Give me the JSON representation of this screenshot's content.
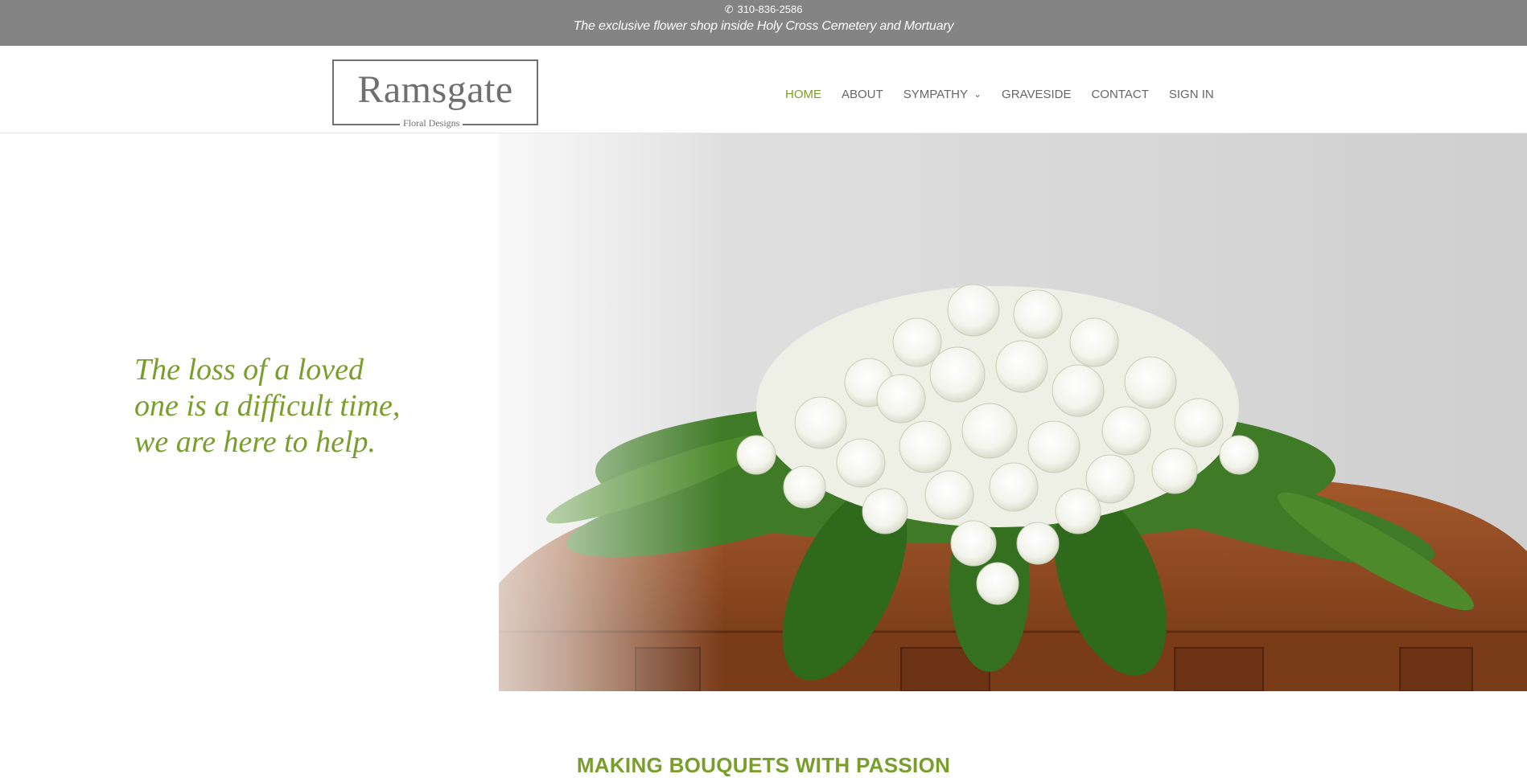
{
  "topbar": {
    "phone_icon": "phone-icon",
    "phone": "310-836-2586",
    "tagline": "The exclusive flower shop inside Holy Cross Cemetery and Mortuary"
  },
  "logo": {
    "brand": "Ramsgate",
    "subtitle": "Floral Designs"
  },
  "nav": {
    "items": [
      {
        "label": "HOME",
        "active": true
      },
      {
        "label": "ABOUT"
      },
      {
        "label": "SYMPATHY",
        "has_dropdown": true
      },
      {
        "label": "GRAVESIDE"
      },
      {
        "label": "CONTACT"
      },
      {
        "label": "SIGN IN"
      }
    ],
    "dropdown_icon": "chevron-down-icon"
  },
  "hero": {
    "headline": "The loss of a loved one is a difficult time, we are here to help.",
    "image_subject": "white-flower-casket-spray-photo"
  },
  "section": {
    "title": "MAKING BOUQUETS WITH PASSION"
  },
  "colors": {
    "accent": "#7a9e2c",
    "topbar_bg": "#848484",
    "nav_text": "#666666"
  }
}
